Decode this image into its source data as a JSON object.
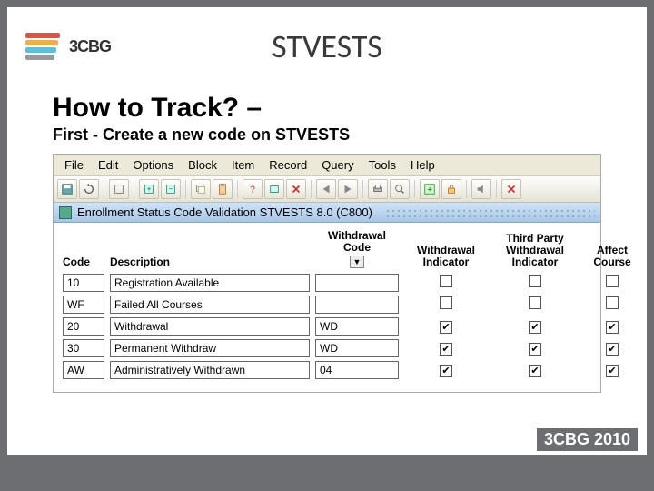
{
  "slide": {
    "logo_text": "3CBG",
    "title": "STVESTS",
    "heading": "How to Track? –",
    "subheading": "First - Create a new code on STVESTS",
    "footer": "3CBG 2010"
  },
  "menubar": {
    "file": "File",
    "edit": "Edit",
    "options": "Options",
    "block": "Block",
    "item": "Item",
    "record": "Record",
    "query": "Query",
    "tools": "Tools",
    "help": "Help"
  },
  "window_caption": "Enrollment Status Code Validation  STVESTS  8.0  (C800)",
  "columns": {
    "code": "Code",
    "desc": "Description",
    "wcode": "Withdrawal Code",
    "wind": "Withdrawal Indicator",
    "tpwind": "Third Party Withdrawal Indicator",
    "affect": "Affect Course"
  },
  "dropdown_arrow": "▼",
  "rows": [
    {
      "code": "10",
      "desc": "Registration Available",
      "wcode": "",
      "wind": false,
      "tpwind": false,
      "affect": false
    },
    {
      "code": "WF",
      "desc": "Failed All Courses",
      "wcode": "",
      "wind": false,
      "tpwind": false,
      "affect": false
    },
    {
      "code": "20",
      "desc": "Withdrawal",
      "wcode": "WD",
      "wind": true,
      "tpwind": true,
      "affect": true
    },
    {
      "code": "30",
      "desc": "Permanent Withdraw",
      "wcode": "WD",
      "wind": true,
      "tpwind": true,
      "affect": true
    },
    {
      "code": "AW",
      "desc": "Administratively Withdrawn",
      "wcode": "04",
      "wind": true,
      "tpwind": true,
      "affect": true
    }
  ]
}
